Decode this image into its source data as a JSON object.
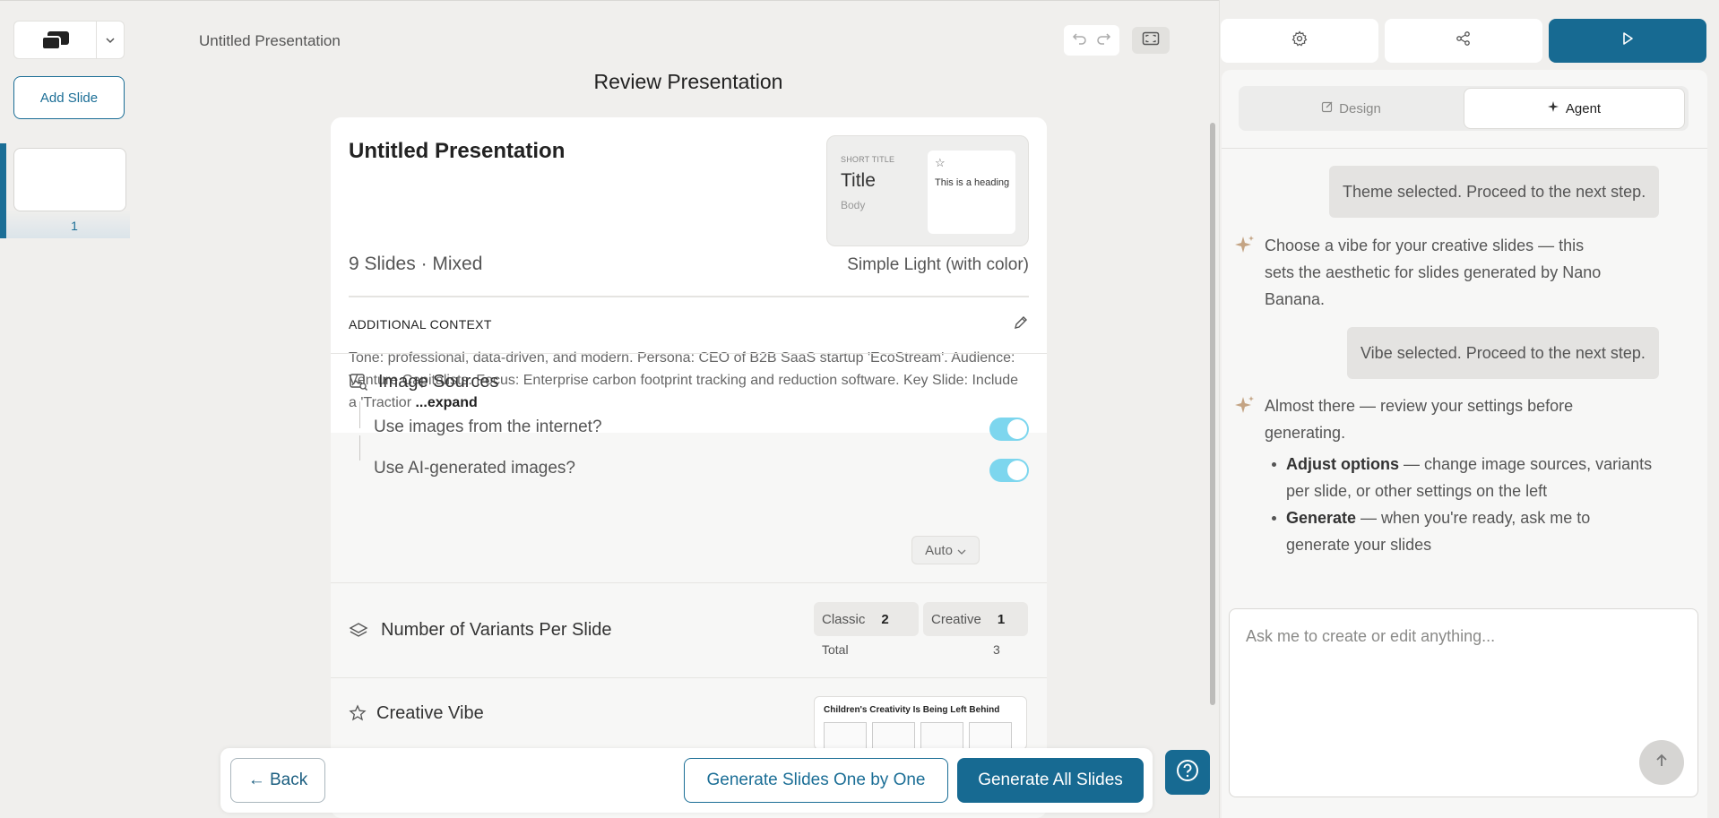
{
  "header": {
    "doc_title": "Untitled Presentation",
    "page_title": "Review Presentation"
  },
  "sidebar": {
    "add_slide_label": "Add Slide",
    "slides": [
      {
        "number": "1"
      }
    ]
  },
  "review": {
    "title": "Untitled Presentation",
    "slide_count": "9 Slides",
    "mode": "· Mixed",
    "theme": {
      "name": "Simple Light (with color)",
      "preview": {
        "short_title": "SHORT TITLE",
        "title": "Title",
        "body": "Body",
        "heading": "This is a heading"
      }
    },
    "additional_context": {
      "label": "ADDITIONAL CONTEXT",
      "text": "Tone: professional, data-driven, and modern. Persona: CEO of B2B SaaS startup 'EcoStream'. Audience: Venture Capitalists. Focus: Enterprise carbon footprint tracking and reduction software. Key Slide: Include a 'Tractior",
      "expand": " ...expand"
    },
    "image_sources": {
      "label": "Image Sources",
      "internet_label": "Use images from the internet?",
      "internet_enabled": true,
      "ai_label": "Use AI-generated images?",
      "ai_mode": "Auto",
      "ai_enabled": true
    },
    "variants": {
      "label": "Number of Variants Per Slide",
      "classic_label": "Classic",
      "classic_value": "2",
      "creative_label": "Creative",
      "creative_value": "1",
      "total_label": "Total",
      "total_value": "3"
    },
    "creative_vibe": {
      "label": "Creative Vibe",
      "preview_title": "Children's Creativity Is Being Left Behind"
    }
  },
  "actions": {
    "back": "← Back",
    "generate_one": "Generate Slides One by One",
    "generate_all": "Generate All Slides"
  },
  "agent_panel": {
    "tabs": [
      {
        "label": "Design",
        "icon": "edit-icon",
        "active": false
      },
      {
        "label": "Agent",
        "icon": "sparkle-icon",
        "active": true
      }
    ],
    "messages": [
      {
        "role": "user",
        "text": "Theme selected. Proceed to the next step."
      },
      {
        "role": "assistant",
        "lines": [
          "Choose a vibe for your creative slides — this",
          "sets the aesthetic for slides generated by Nano",
          "Banana."
        ]
      },
      {
        "role": "user",
        "text": "Vibe selected. Proceed to the next step."
      },
      {
        "role": "assistant",
        "lines": [
          "Almost there — review your settings before",
          "generating."
        ],
        "bullets": [
          {
            "bold": "Adjust options",
            "text": " — change image sources, variants per slide, or other settings on the left"
          },
          {
            "bold": "Generate",
            "text": " — when you're ready, ask me to generate your slides"
          }
        ]
      }
    ],
    "input_placeholder": "Ask me to create or edit anything..."
  },
  "colors": {
    "accent": "#176a92",
    "toggle_on": "#7dd6ee",
    "background": "#f0efed"
  }
}
